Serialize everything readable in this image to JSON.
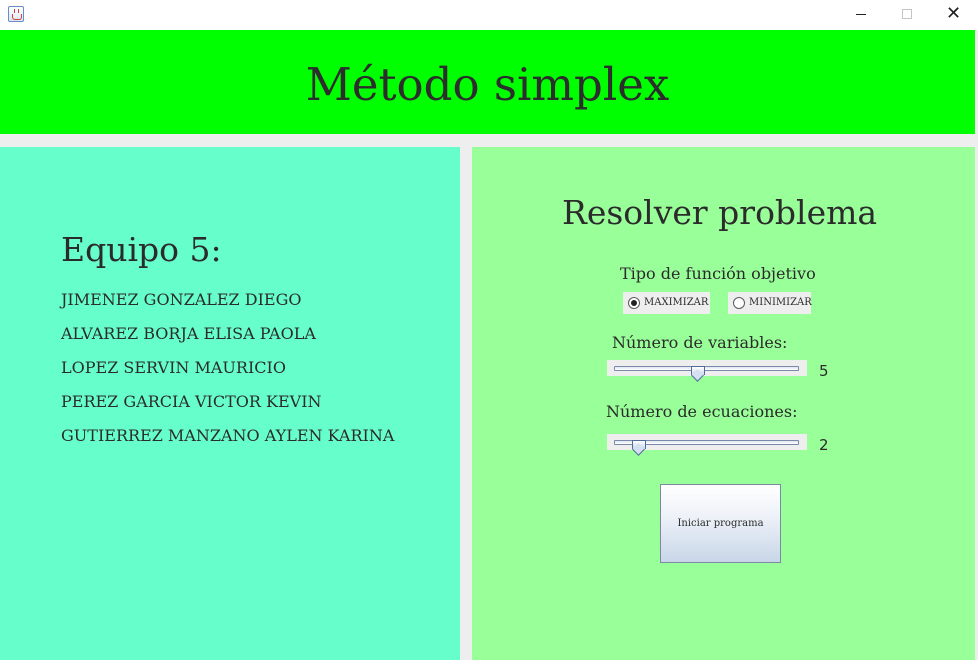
{
  "window": {
    "minimize_glyph": "",
    "maximize_glyph": "",
    "close_glyph": "✕"
  },
  "header": {
    "title": "Método simplex"
  },
  "team": {
    "title": "Equipo 5:",
    "members": [
      "JIMENEZ GONZALEZ DIEGO",
      "ALVAREZ BORJA ELISA PAOLA",
      "LOPEZ SERVIN MAURICIO",
      "PEREZ GARCIA VICTOR KEVIN",
      "GUTIERREZ MANZANO AYLEN KARINA"
    ]
  },
  "solver": {
    "title": "Resolver problema",
    "objective": {
      "label": "Tipo de función objetivo",
      "options": [
        "MAXIMIZAR",
        "MINIMIZAR"
      ],
      "selected": "MAXIMIZAR"
    },
    "variables": {
      "label": "Número de variables:",
      "value": "5",
      "min": 1,
      "max": 10,
      "level": 0.45
    },
    "equations": {
      "label": "Número de ecuaciones:",
      "value": "2",
      "min": 1,
      "max": 10,
      "level": 0.1
    },
    "start_label": "Iniciar programa"
  },
  "colors": {
    "header_bg": "#00ff00",
    "team_panel_bg": "#66ffcc",
    "solver_panel_bg": "#99ff99"
  },
  "icons": {
    "app": "java-app-icon",
    "minimize": "minimize-icon",
    "maximize": "maximize-icon",
    "close": "close-icon"
  }
}
